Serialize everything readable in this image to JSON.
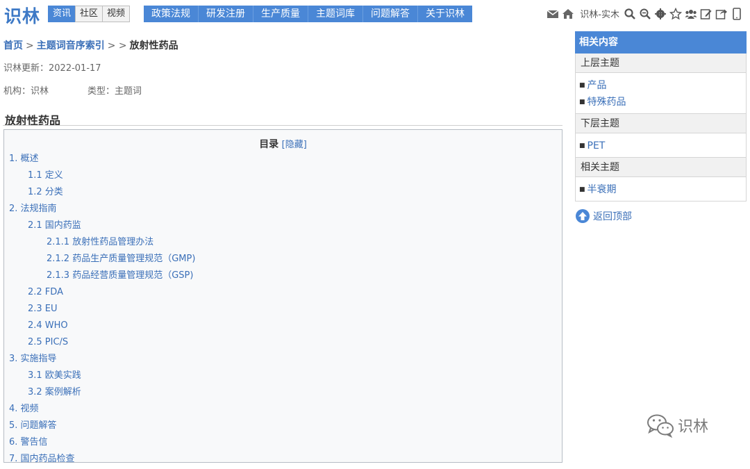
{
  "header": {
    "logo": "识林",
    "mini_tabs": [
      "资讯",
      "社区",
      "视频"
    ],
    "nav": [
      "政策法规",
      "研发注册",
      "生产质量",
      "主题词库",
      "问题解答",
      "关于识林"
    ],
    "user_name": "识林-实木",
    "icons": [
      "mail-icon",
      "home-icon",
      "search-icon",
      "zoom-icon",
      "gear-icon",
      "star-icon",
      "group-icon",
      "edit-icon",
      "share-icon",
      "mobile-icon"
    ]
  },
  "breadcrumb": {
    "home": "首页",
    "index": "主题词音序索引",
    "sep1": ">",
    "sep2": "> >",
    "current": "放射性药品"
  },
  "meta": {
    "update": "识林更新：2022-01-17",
    "org": "机构：识林",
    "type": "类型：主题词"
  },
  "page_title": "放射性药品",
  "toc": {
    "title": "目录",
    "toggle": "[隐藏]",
    "items": [
      {
        "level": 1,
        "text": "1. 概述"
      },
      {
        "level": 2,
        "text": "1.1 定义"
      },
      {
        "level": 2,
        "text": "1.2 分类"
      },
      {
        "level": 1,
        "text": "2. 法规指南"
      },
      {
        "level": 2,
        "text": "2.1 国内药监"
      },
      {
        "level": 3,
        "text": "2.1.1 放射性药品管理办法"
      },
      {
        "level": 3,
        "text": "2.1.2 药品生产质量管理规范（GMP)"
      },
      {
        "level": 3,
        "text": "2.1.3 药品经营质量管理规范（GSP)"
      },
      {
        "level": 2,
        "text": "2.2 FDA"
      },
      {
        "level": 2,
        "text": "2.3 EU"
      },
      {
        "level": 2,
        "text": "2.4 WHO"
      },
      {
        "level": 2,
        "text": "2.5 PIC/S"
      },
      {
        "level": 1,
        "text": "3. 实施指导"
      },
      {
        "level": 2,
        "text": "3.1 欧美实践"
      },
      {
        "level": 2,
        "text": "3.2 案例解析"
      },
      {
        "level": 1,
        "text": "4. 视频"
      },
      {
        "level": 1,
        "text": "5. 问题解答"
      },
      {
        "level": 1,
        "text": "6. 警告信"
      },
      {
        "level": 1,
        "text": "7. 国内药品检查"
      }
    ]
  },
  "sidebar": {
    "title": "相关内容",
    "sections": [
      {
        "name": "上层主题",
        "items": [
          "产品",
          "特殊药品"
        ]
      },
      {
        "name": "下层主题",
        "items": [
          "PET"
        ]
      },
      {
        "name": "相关主题",
        "items": [
          "半衰期"
        ]
      }
    ],
    "back_top": "返回顶部"
  },
  "watermark": "识林",
  "colors": {
    "accent": "#4a87d6",
    "link": "#3a6fb8"
  }
}
